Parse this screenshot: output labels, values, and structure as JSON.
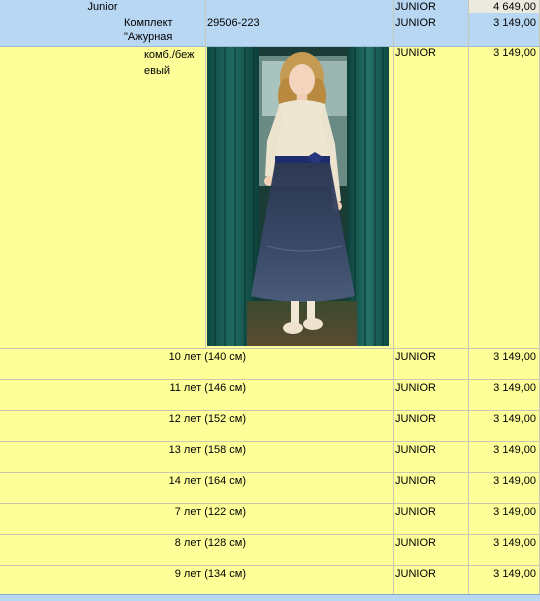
{
  "group_row": {
    "name": "Junior",
    "brand": "JUNIOR",
    "price": "4 649,00"
  },
  "product_row": {
    "name_line1": "Комплект",
    "name_line2": "\"Ажурная",
    "article": "29506-223",
    "brand": "JUNIOR",
    "price": "3 149,00"
  },
  "variant_row": {
    "color_line1": "комб./беж",
    "color_line2": "евый",
    "brand": "JUNIOR",
    "price": "3 149,00",
    "photo_icon": "product-photo-girl-lace-top-tulle-skirt"
  },
  "sizes": [
    {
      "size": "10 лет (140 см)",
      "brand": "JUNIOR",
      "price": "3 149,00"
    },
    {
      "size": "11 лет (146 см)",
      "brand": "JUNIOR",
      "price": "3 149,00"
    },
    {
      "size": "12 лет (152 см)",
      "brand": "JUNIOR",
      "price": "3 149,00"
    },
    {
      "size": "13 лет (158 см)",
      "brand": "JUNIOR",
      "price": "3 149,00"
    },
    {
      "size": "14 лет (164 см)",
      "brand": "JUNIOR",
      "price": "3 149,00"
    },
    {
      "size": "7 лет (122 см)",
      "brand": "JUNIOR",
      "price": "3 149,00"
    },
    {
      "size": "8 лет (128 см)",
      "brand": "JUNIOR",
      "price": "3 149,00"
    },
    {
      "size": "9 лет (134 см)",
      "brand": "JUNIOR",
      "price": "3 149,00"
    }
  ],
  "colors": {
    "group_bg": "#b8d7f2",
    "variant_bg": "#ffff99",
    "price_header_bg": "#eceadf"
  }
}
